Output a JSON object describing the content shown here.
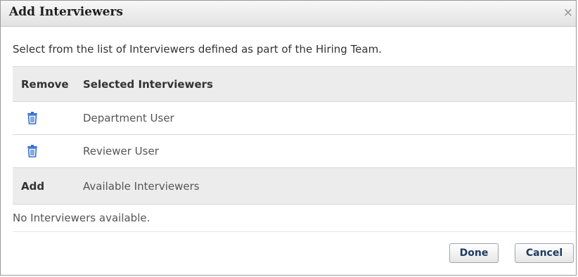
{
  "dialog": {
    "title": "Add Interviewers",
    "close_symbol": "×",
    "intro": "Select from the list of Interviewers defined as part of the Hiring Team."
  },
  "selected_table": {
    "col_remove": "Remove",
    "col_selected": "Selected Interviewers",
    "rows": [
      {
        "name": "Department User",
        "icon": "trash-icon"
      },
      {
        "name": "Reviewer User",
        "icon": "trash-icon"
      }
    ]
  },
  "available_table": {
    "col_add": "Add",
    "col_available": "Available Interviewers",
    "empty_message": "No Interviewers available."
  },
  "buttons": {
    "done": "Done",
    "cancel": "Cancel"
  },
  "colors": {
    "trash_icon": "#2f6fd0",
    "header_bg": "#ececec",
    "button_text": "#1e3a63"
  }
}
